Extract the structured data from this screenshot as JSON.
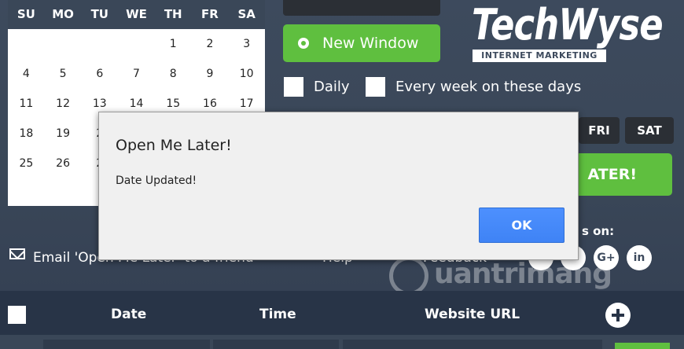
{
  "calendar": {
    "weekdays": [
      "SU",
      "MO",
      "TU",
      "WE",
      "TH",
      "FR",
      "SA"
    ],
    "weeks": [
      [
        "",
        "",
        "",
        "",
        "1",
        "2",
        "3"
      ],
      [
        "4",
        "5",
        "6",
        "7",
        "8",
        "9",
        "10"
      ],
      [
        "11",
        "12",
        "13",
        "14",
        "15",
        "16",
        "17"
      ],
      [
        "18",
        "19",
        "2",
        "",
        "",
        "",
        ""
      ],
      [
        "25",
        "26",
        "2",
        "",
        "",
        "",
        ""
      ]
    ]
  },
  "controls": {
    "new_window_label": "New Window",
    "daily_label": "Daily",
    "every_week_label": "Every week on these days",
    "day_fri": "FRI",
    "day_sat": "SAT",
    "big_button_partial": "ATER!"
  },
  "logo": {
    "main": "TechWyse",
    "sub": "INTERNET MARKETING"
  },
  "footer": {
    "email_friend": "Email 'Open Me Later' to a friend",
    "help": "Help",
    "feedback": "Feedback",
    "follow_partial": "s on:",
    "social_google": "G+",
    "social_linkedin": "in"
  },
  "watermark": "uantrimang",
  "table": {
    "headers": {
      "date": "Date",
      "time": "Time",
      "url": "Website URL"
    }
  },
  "dialog": {
    "title": "Open Me Later!",
    "message": "Date Updated!",
    "ok": "OK"
  }
}
